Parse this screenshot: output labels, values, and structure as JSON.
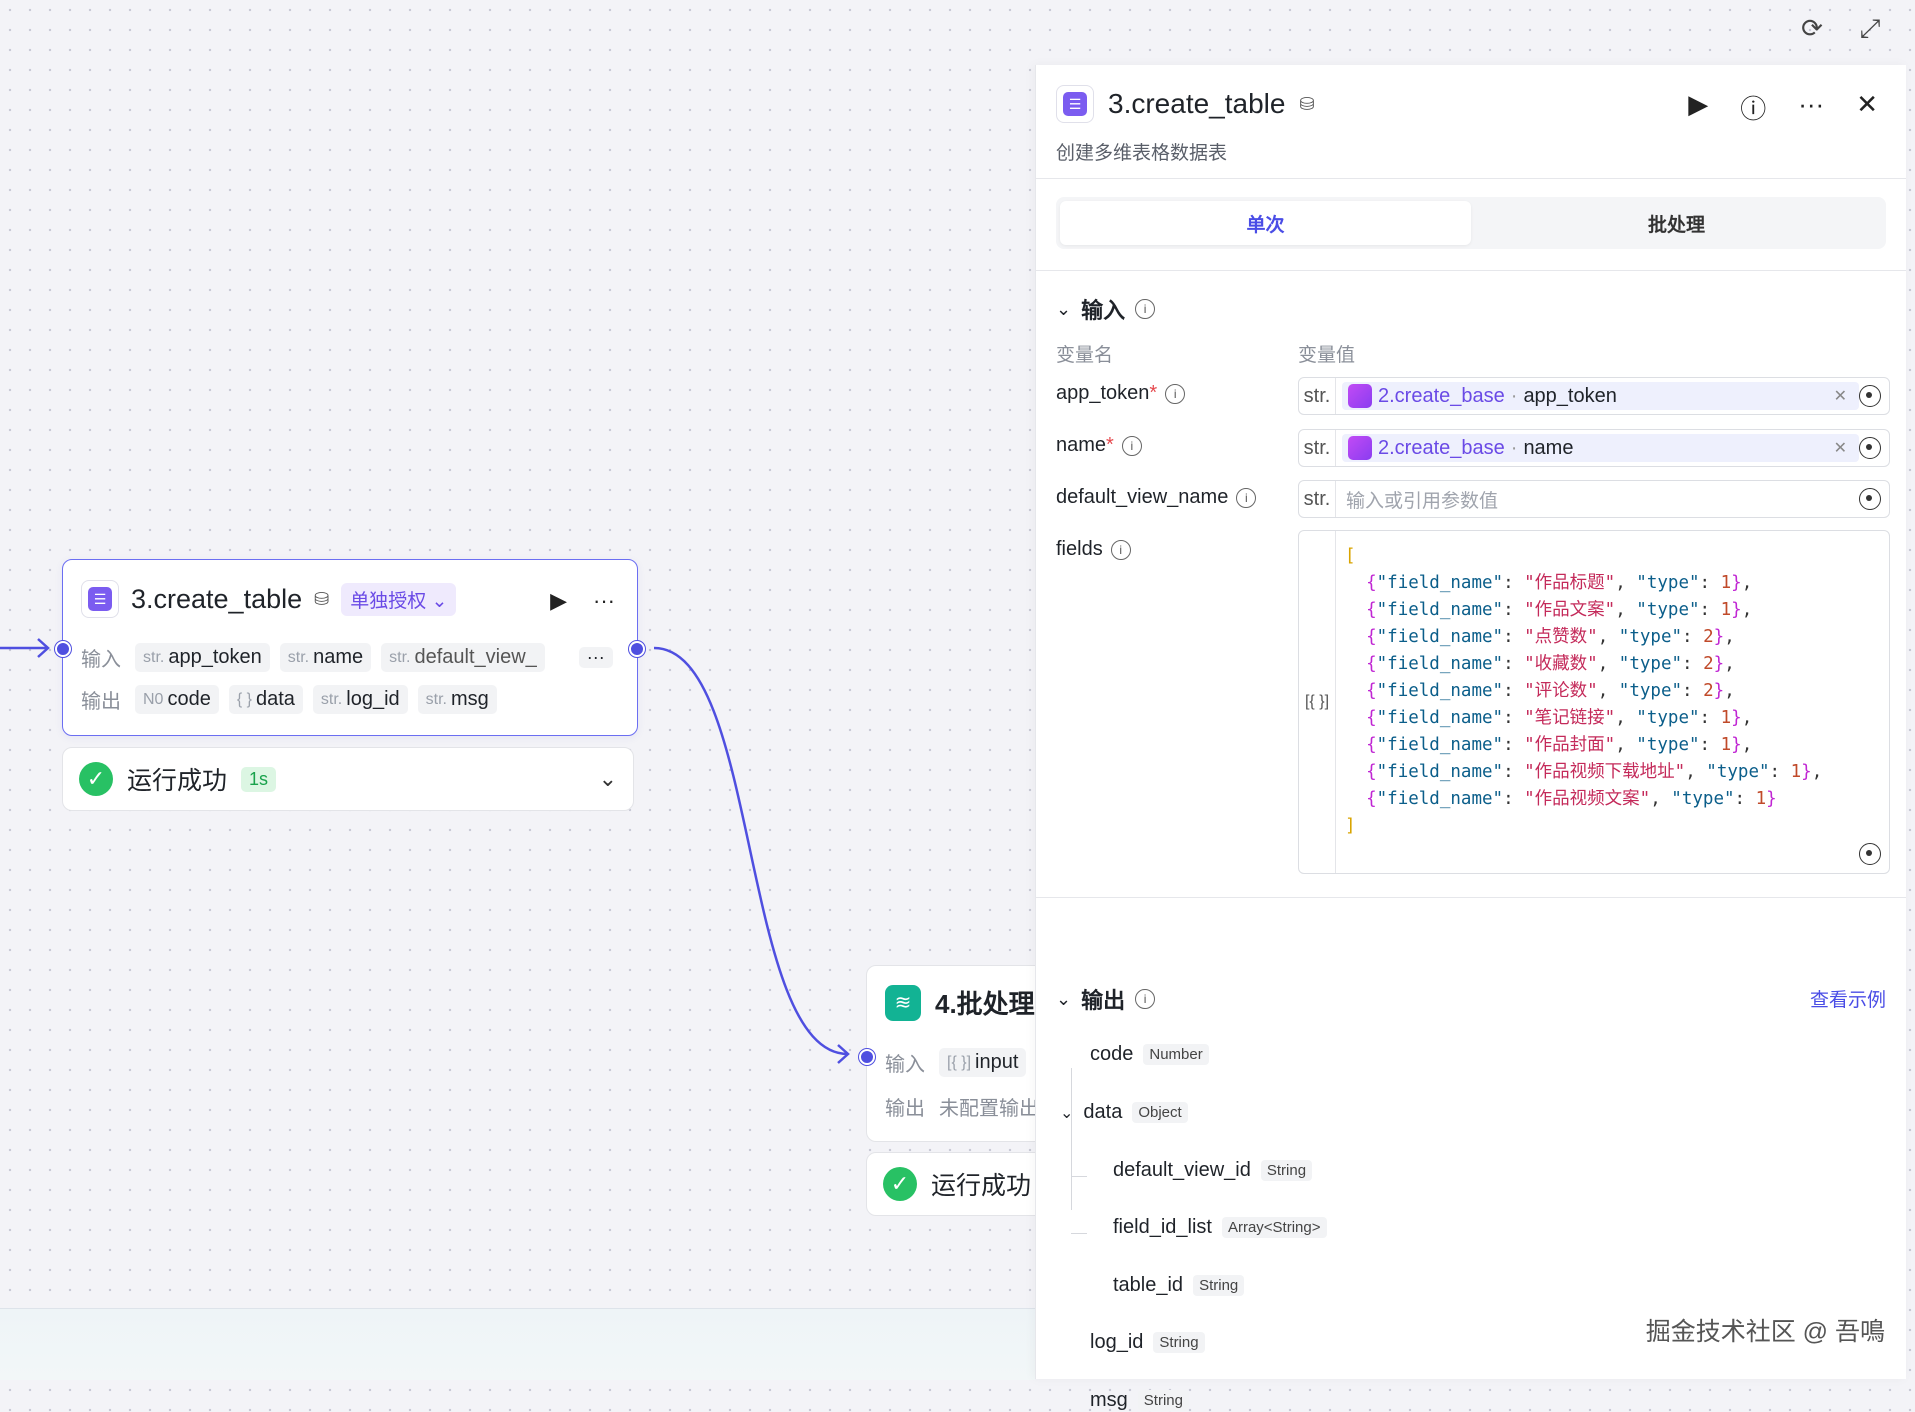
{
  "window": {
    "refresh_icon": "refresh-icon",
    "fullscreen_icon": "expand-icon"
  },
  "node3": {
    "title": "3.create_table",
    "auth_badge": "单独授权",
    "input_label": "输入",
    "output_label": "输出",
    "inputs": [
      {
        "type": "str.",
        "name": "app_token"
      },
      {
        "type": "str.",
        "name": "name"
      },
      {
        "type": "str.",
        "name": "default_view_"
      }
    ],
    "more": "···",
    "outputs": [
      {
        "type": "N0",
        "name": "code"
      },
      {
        "type": "{ }",
        "name": "data"
      },
      {
        "type": "str.",
        "name": "log_id"
      },
      {
        "type": "str.",
        "name": "msg"
      }
    ],
    "status": "运行成功",
    "duration": "1s"
  },
  "node4": {
    "title": "4.批处理",
    "input_label": "输入",
    "input_type": "[{ }]",
    "input_name": "input",
    "output_label": "输出",
    "output_text": "未配置输出",
    "status": "运行成功"
  },
  "panel": {
    "title": "3.create_table",
    "subtitle": "创建多维表格数据表",
    "tabs": [
      "单次",
      "批处理"
    ],
    "input_section": "输入",
    "col_name": "变量名",
    "col_value": "变量值",
    "vars": [
      {
        "name": "app_token",
        "required": "*",
        "type": "str.",
        "src": "2.create_base",
        "field": "app_token"
      },
      {
        "name": "name",
        "required": "*",
        "type": "str.",
        "src": "2.create_base",
        "field": "name"
      },
      {
        "name": "default_view_name",
        "type": "str.",
        "placeholder": "输入或引用参数值"
      },
      {
        "name": "fields",
        "type": "[{ }]"
      }
    ],
    "fields_json": [
      [
        "作品标题",
        "1"
      ],
      [
        "作品文案",
        "1"
      ],
      [
        "点赞数",
        "2"
      ],
      [
        "收藏数",
        "2"
      ],
      [
        "评论数",
        "2"
      ],
      [
        "笔记链接",
        "1"
      ],
      [
        "作品封面",
        "1"
      ],
      [
        "作品视频下载地址",
        "1"
      ],
      [
        "作品视频文案",
        "1"
      ]
    ],
    "output_section": "输出",
    "view_example": "查看示例",
    "outputs": [
      {
        "name": "code",
        "type": "Number"
      },
      {
        "name": "data",
        "type": "Object"
      },
      {
        "name": "default_view_id",
        "type": "String"
      },
      {
        "name": "field_id_list",
        "type": "Array<String>"
      },
      {
        "name": "table_id",
        "type": "String"
      },
      {
        "name": "log_id",
        "type": "String"
      },
      {
        "name": "msg",
        "type": "String"
      }
    ]
  },
  "watermark": "掘金技术社区 @ 吾鳴",
  "colors": {
    "accent": "#4a4de6",
    "edge": "#4f4fe0",
    "success": "#28c164"
  }
}
